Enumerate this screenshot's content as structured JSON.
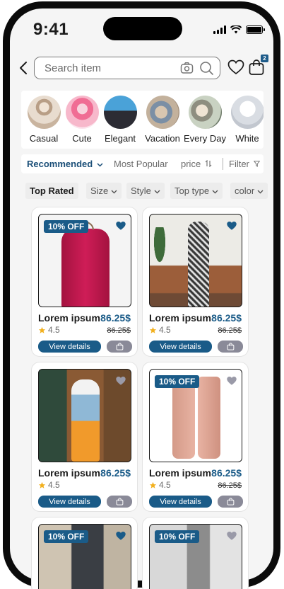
{
  "status": {
    "time": "9:41"
  },
  "search": {
    "placeholder": "Search item"
  },
  "header": {
    "cart_count": "2"
  },
  "categories": [
    {
      "label": "Casual"
    },
    {
      "label": "Cute"
    },
    {
      "label": "Elegant"
    },
    {
      "label": "Vacation"
    },
    {
      "label": "Every Day"
    },
    {
      "label": "White"
    }
  ],
  "sort": {
    "recommended": "Recommended",
    "most_popular": "Most Popular",
    "price": "price",
    "filter": "Filter"
  },
  "filters": {
    "top_rated": "Top Rated",
    "size": "Size",
    "style": "Style",
    "top_type": "Top type",
    "color": "color"
  },
  "products": [
    {
      "name": "Lorem ipsum",
      "price": "86.25$",
      "rating": "4.5",
      "old_price": "86.25$",
      "discount": "10% OFF",
      "view": "View details"
    },
    {
      "name": "Lorem ipsum",
      "price": "86.25$",
      "rating": "4.5",
      "old_price": "86.25$",
      "discount": "",
      "view": "View details"
    },
    {
      "name": "Lorem ipsum",
      "price": "86.25$",
      "rating": "4.5",
      "old_price": "",
      "discount": "",
      "view": "View details"
    },
    {
      "name": "Lorem ipsum",
      "price": "86.25$",
      "rating": "4.5",
      "old_price": "86.25$",
      "discount": "10% OFF",
      "view": "View details"
    },
    {
      "discount": "10% OFF"
    },
    {
      "discount": "10% OFF"
    }
  ],
  "colors": {
    "accent": "#1a5b88",
    "muted_button": "#8a8a98"
  }
}
